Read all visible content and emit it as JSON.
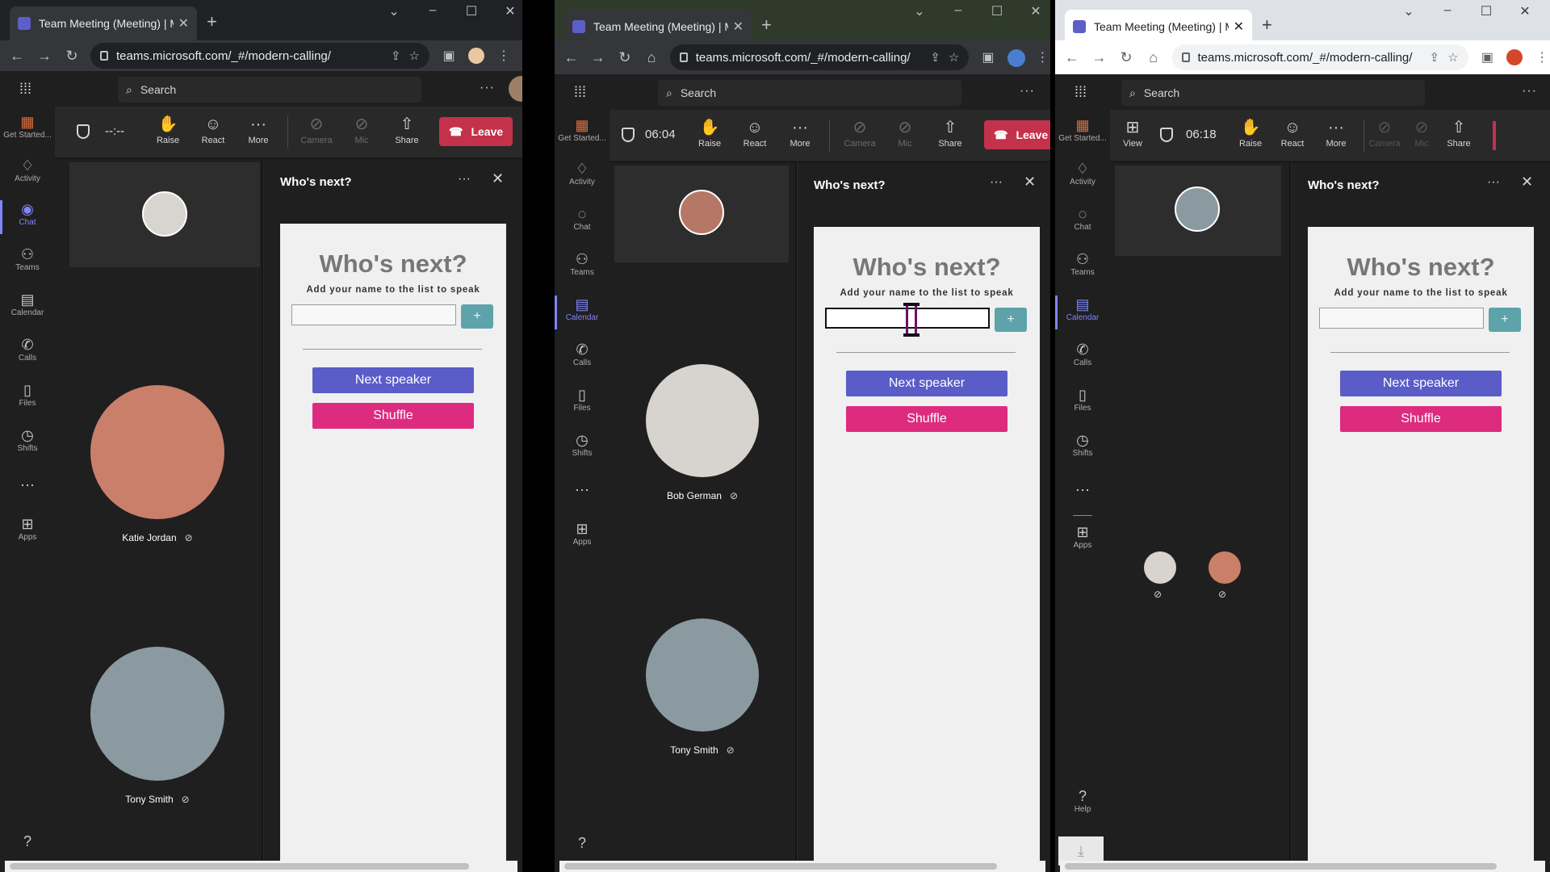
{
  "colors": {
    "accent": "#7f85f5",
    "leave": "#c4314b",
    "next": "#5a5cc8",
    "shuffle": "#dd2b80",
    "plus": "#5fa3aa"
  },
  "browser": {
    "tab_title": "Team Meeting (Meeting) | Micro",
    "url": "teams.microsoft.com/_#/modern-calling/"
  },
  "teams": {
    "search_placeholder": "Search",
    "rail": {
      "getstarted": "Get Started...",
      "activity": "Activity",
      "chat": "Chat",
      "teams": "Teams",
      "calendar": "Calendar",
      "calls": "Calls",
      "files": "Files",
      "shifts": "Shifts",
      "apps": "Apps",
      "help": "Help"
    },
    "controls": {
      "view": "View",
      "raise": "Raise",
      "react": "React",
      "more": "More",
      "camera": "Camera",
      "mic": "Mic",
      "share": "Share",
      "leave": "Leave"
    }
  },
  "panel": {
    "title": "Who's next?",
    "heading": "Who's next?",
    "subtitle": "Add your name to the list to speak",
    "plus": "+",
    "next_speaker": "Next speaker",
    "shuffle": "Shuffle"
  },
  "windows": [
    {
      "timer": "--:--",
      "participants": [
        "Katie Jordan",
        "Tony Smith"
      ]
    },
    {
      "timer": "06:04",
      "participants": [
        "Bob German",
        "Tony Smith"
      ]
    },
    {
      "timer": "06:18",
      "participants": []
    }
  ]
}
